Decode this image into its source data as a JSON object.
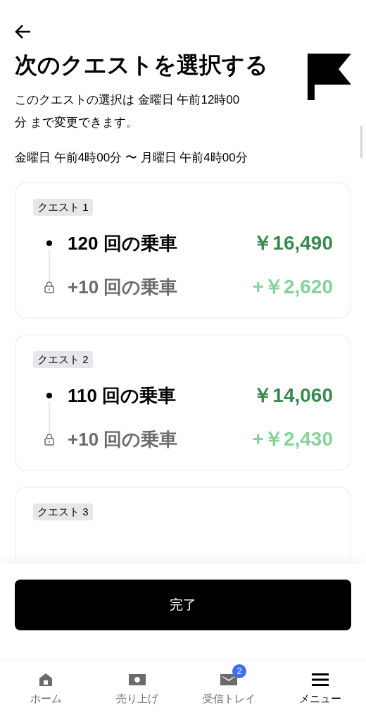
{
  "header": {
    "title": "次のクエストを選択する",
    "description": "このクエストの選択は 金曜日 午前12時00分 まで変更できます。",
    "period": "金曜日 午前4時00分 〜 月曜日 午前4時00分"
  },
  "quests": [
    {
      "label": "クエスト 1",
      "rows": [
        {
          "kind": "main",
          "rides": "120 回の乗車",
          "reward": "￥16,490"
        },
        {
          "kind": "bonus",
          "rides": "+10 回の乗車",
          "reward": "+￥2,620"
        }
      ]
    },
    {
      "label": "クエスト 2",
      "rows": [
        {
          "kind": "main",
          "rides": "110 回の乗車",
          "reward": "￥14,060"
        },
        {
          "kind": "bonus",
          "rides": "+10 回の乗車",
          "reward": "+￥2,430"
        }
      ]
    },
    {
      "label": "クエスト 3"
    }
  ],
  "done_button": "完了",
  "nav": [
    {
      "kind": "home",
      "label": "ホーム",
      "selected": false
    },
    {
      "kind": "earnings",
      "label": "売り上げ",
      "selected": false
    },
    {
      "kind": "inbox",
      "label": "受信トレイ",
      "selected": false,
      "badge": "2"
    },
    {
      "kind": "menu",
      "label": "メニュー",
      "selected": true
    }
  ]
}
